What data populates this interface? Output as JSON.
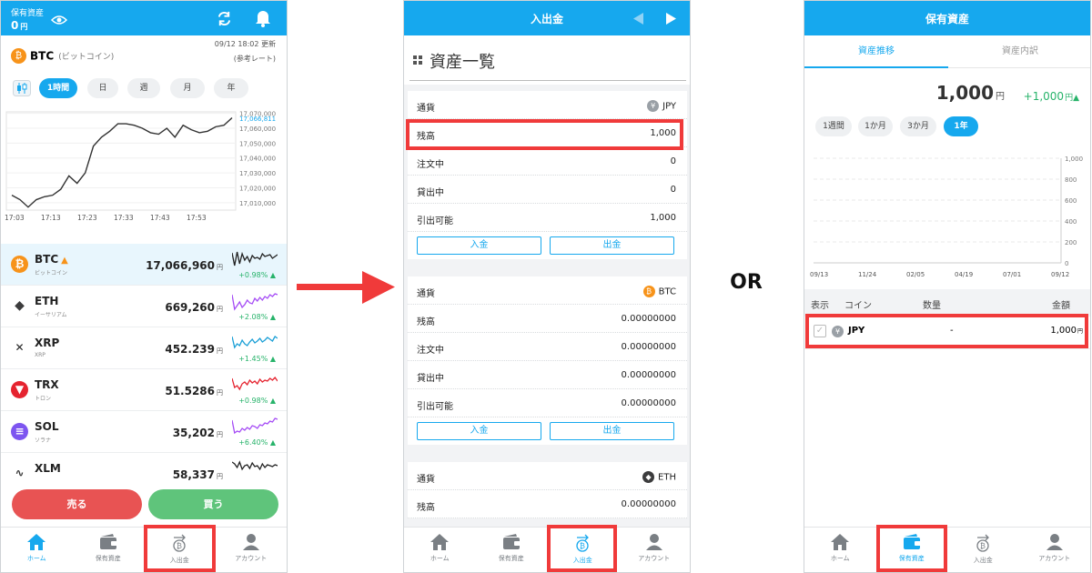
{
  "panel1": {
    "header_label": "保有資産",
    "header_value": "0",
    "header_unit": "円",
    "coin_symbol": "BTC",
    "coin_name": "(ビットコイン)",
    "updated": "09/12 18:02 更新",
    "ref_rate": "(参考レート)",
    "tabs": [
      {
        "label": "1時間",
        "active": true
      },
      {
        "label": "日",
        "active": false
      },
      {
        "label": "週",
        "active": false
      },
      {
        "label": "月",
        "active": false
      },
      {
        "label": "年",
        "active": false
      }
    ],
    "y_ticks": [
      "17,070,000",
      "17,060,000",
      "17,050,000",
      "17,040,000",
      "17,030,000",
      "17,020,000",
      "17,010,000"
    ],
    "current_label": "17,066,811",
    "x_ticks": [
      "17:03",
      "17:13",
      "17:23",
      "17:33",
      "17:43",
      "17:53"
    ],
    "coins": [
      {
        "symbol": "BTC",
        "name": "ビットコイン",
        "price": "17,066,960",
        "unit": "円",
        "change": "+0.98% ▲",
        "color": "#f7931a",
        "spark": "#222222",
        "highlight": true
      },
      {
        "symbol": "ETH",
        "name": "イーサリアム",
        "price": "669,260",
        "unit": "円",
        "change": "+2.08% ▲",
        "color": "#3c3c3d",
        "spark": "#a54cf5",
        "highlight": false
      },
      {
        "symbol": "XRP",
        "name": "XRP",
        "price": "452.239",
        "unit": "円",
        "change": "+1.45% ▲",
        "color": "#222222",
        "spark": "#1a9fd6",
        "highlight": false
      },
      {
        "symbol": "TRX",
        "name": "トロン",
        "price": "51.5286",
        "unit": "円",
        "change": "+0.98% ▲",
        "color": "#e5232f",
        "spark": "#e5232f",
        "highlight": false
      },
      {
        "symbol": "SOL",
        "name": "ソラナ",
        "price": "35,202",
        "unit": "円",
        "change": "+6.40% ▲",
        "color": "#7d55f0",
        "spark": "#a54cf5",
        "highlight": false
      },
      {
        "symbol": "XLM",
        "name": "",
        "price": "58,337",
        "unit": "円",
        "change": "",
        "color": "#333333",
        "spark": "#222222",
        "highlight": false
      }
    ],
    "sell_label": "売る",
    "buy_label": "買う",
    "nav": [
      "ホーム",
      "保有資産",
      "入出金",
      "アカウント"
    ]
  },
  "center_label": "OR",
  "panel2": {
    "title": "入出金",
    "section_title": "資産一覧",
    "rows": [
      "通貨",
      "残高",
      "注文中",
      "貸出中",
      "引出可能"
    ],
    "cards": [
      {
        "currency": "JPY",
        "badge": "¥",
        "color": "#9aa0a6",
        "values": [
          "1,000",
          "0",
          "0",
          "1,000"
        ]
      },
      {
        "currency": "BTC",
        "badge": "₿",
        "color": "#f7931a",
        "values": [
          "0.00000000",
          "0.00000000",
          "0.00000000",
          "0.00000000"
        ]
      },
      {
        "currency": "ETH",
        "badge": "◆",
        "color": "#3c3c3d",
        "values": [
          "0.00000000"
        ]
      }
    ],
    "deposit": "入金",
    "withdraw": "出金",
    "nav": [
      "ホーム",
      "保有資産",
      "入出金",
      "アカウント"
    ]
  },
  "panel3": {
    "title": "保有資産",
    "tabs": [
      "資産推移",
      "資産内訳"
    ],
    "total": "1,000",
    "unit": "円",
    "change": "+1,000",
    "change_unit": "円▲",
    "periods": [
      {
        "label": "1週間",
        "active": false
      },
      {
        "label": "1か月",
        "active": false
      },
      {
        "label": "3か月",
        "active": false
      },
      {
        "label": "1年",
        "active": true
      }
    ],
    "y_ticks": [
      "1,000",
      "800",
      "600",
      "400",
      "200",
      "0"
    ],
    "x_ticks": [
      "09/13",
      "11/24",
      "02/05",
      "04/19",
      "07/01",
      "09/12"
    ],
    "table_headers": [
      "表示",
      "コイン",
      "数量",
      "金額"
    ],
    "row": {
      "coin": "JPY",
      "qty": "-",
      "amount": "1,000",
      "unit": "円"
    },
    "nav": [
      "ホーム",
      "保有資産",
      "入出金",
      "アカウント"
    ]
  },
  "chart_data": {
    "type": "line",
    "x": [
      "17:01",
      "17:03",
      "17:06",
      "17:08",
      "17:10",
      "17:12",
      "17:14",
      "17:16",
      "17:18",
      "17:20",
      "17:21",
      "17:23",
      "17:25",
      "17:27",
      "17:30",
      "17:33",
      "17:35",
      "17:38",
      "17:40",
      "17:43",
      "17:45",
      "17:48",
      "17:50",
      "17:53",
      "17:55",
      "17:57",
      "17:59"
    ],
    "series": [
      {
        "values": [
          17015000,
          17012000,
          17007000,
          17012000,
          17014000,
          17015000,
          17019000,
          17028000,
          17023000,
          17030000,
          17048000,
          17054000,
          17058000,
          17063000,
          17063000,
          17062000,
          17060000,
          17057000,
          17056000,
          17060000,
          17054000,
          17062000,
          17059000,
          17057000,
          17058000,
          17061000,
          17062000,
          17067000
        ]
      }
    ],
    "x_ticks": [
      "17:03",
      "17:13",
      "17:23",
      "17:33",
      "17:43",
      "17:53"
    ],
    "ylim": [
      17005000,
      17071000
    ]
  }
}
